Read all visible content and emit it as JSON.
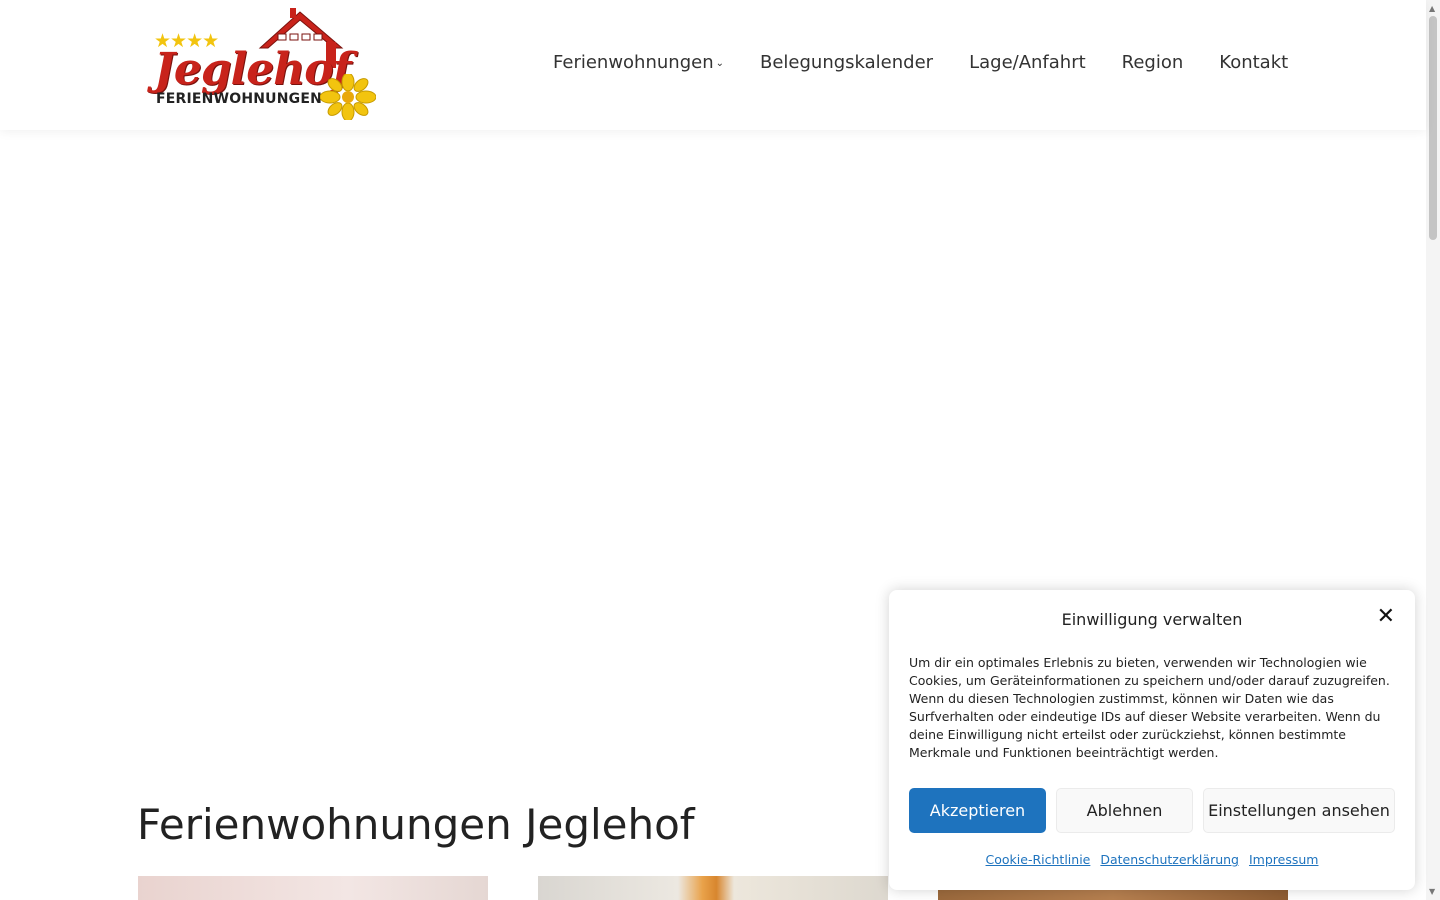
{
  "logo": {
    "stars": "★★★★",
    "name": "Jeglehof",
    "subtitle": "FERIENWOHNUNGEN",
    "colors": {
      "red": "#c8231b",
      "yellow": "#f2c40f"
    }
  },
  "nav": {
    "items": [
      {
        "label": "Ferienwohnungen",
        "has_dropdown": true
      },
      {
        "label": "Belegungskalender"
      },
      {
        "label": "Lage/Anfahrt"
      },
      {
        "label": "Region"
      },
      {
        "label": "Kontakt"
      }
    ],
    "dropdown_icon": "chevron-down-icon"
  },
  "main": {
    "heading": "Ferienwohnungen Jeglehof"
  },
  "consent": {
    "title": "Einwilligung verwalten",
    "close_icon": "close-icon",
    "text": "Um dir ein optimales Erlebnis zu bieten, verwenden wir Technologien wie Cookies, um Geräteinformationen zu speichern und/oder darauf zuzugreifen. Wenn du diesen Technologien zustimmst, können wir Daten wie das Surfverhalten oder eindeutige IDs auf dieser Website verarbeiten. Wenn du deine Einwilligung nicht erteilst oder zurückziehst, können bestimmte Merkmale und Funktionen beeinträchtigt werden.",
    "accept_label": "Akzeptieren",
    "deny_label": "Ablehnen",
    "settings_label": "Einstellungen ansehen",
    "links": {
      "cookie_policy": "Cookie-Richtlinie",
      "privacy": "Datenschutzerklärung",
      "imprint": "Impressum"
    },
    "accent_color": "#1e73be"
  }
}
